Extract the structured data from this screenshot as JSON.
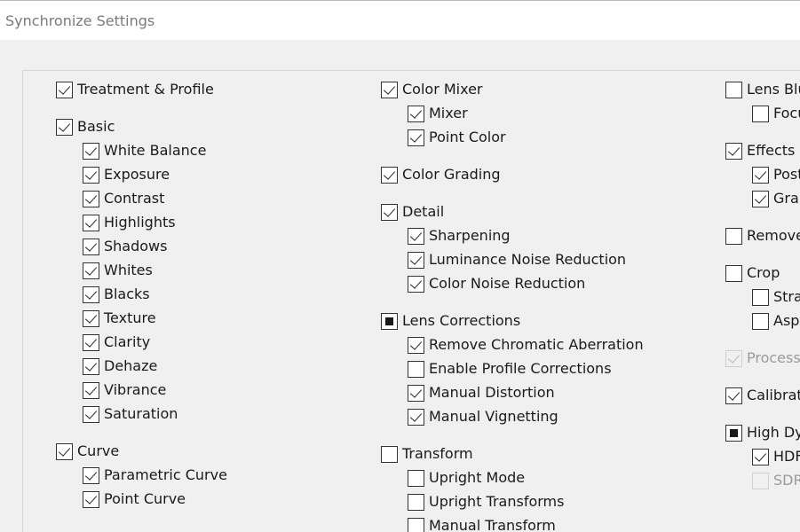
{
  "window": {
    "title": "Synchronize Settings"
  },
  "columns": [
    {
      "items": [
        {
          "label": "Treatment & Profile",
          "state": "checked",
          "indent": false,
          "disabled": false
        },
        {
          "label": "Basic",
          "state": "checked",
          "indent": false,
          "disabled": false
        },
        {
          "label": "White Balance",
          "state": "checked",
          "indent": true,
          "disabled": false
        },
        {
          "label": "Exposure",
          "state": "checked",
          "indent": true,
          "disabled": false
        },
        {
          "label": "Contrast",
          "state": "checked",
          "indent": true,
          "disabled": false
        },
        {
          "label": "Highlights",
          "state": "checked",
          "indent": true,
          "disabled": false
        },
        {
          "label": "Shadows",
          "state": "checked",
          "indent": true,
          "disabled": false
        },
        {
          "label": "Whites",
          "state": "checked",
          "indent": true,
          "disabled": false
        },
        {
          "label": "Blacks",
          "state": "checked",
          "indent": true,
          "disabled": false
        },
        {
          "label": "Texture",
          "state": "checked",
          "indent": true,
          "disabled": false
        },
        {
          "label": "Clarity",
          "state": "checked",
          "indent": true,
          "disabled": false
        },
        {
          "label": "Dehaze",
          "state": "checked",
          "indent": true,
          "disabled": false
        },
        {
          "label": "Vibrance",
          "state": "checked",
          "indent": true,
          "disabled": false
        },
        {
          "label": "Saturation",
          "state": "checked",
          "indent": true,
          "disabled": false
        },
        {
          "label": "Curve",
          "state": "checked",
          "indent": false,
          "disabled": false
        },
        {
          "label": "Parametric Curve",
          "state": "checked",
          "indent": true,
          "disabled": false
        },
        {
          "label": "Point Curve",
          "state": "checked",
          "indent": true,
          "disabled": false
        }
      ]
    },
    {
      "items": [
        {
          "label": "Color Mixer",
          "state": "checked",
          "indent": false,
          "disabled": false
        },
        {
          "label": "Mixer",
          "state": "checked",
          "indent": true,
          "disabled": false
        },
        {
          "label": "Point Color",
          "state": "checked",
          "indent": true,
          "disabled": false
        },
        {
          "label": "Color Grading",
          "state": "checked",
          "indent": false,
          "disabled": false
        },
        {
          "label": "Detail",
          "state": "checked",
          "indent": false,
          "disabled": false
        },
        {
          "label": "Sharpening",
          "state": "checked",
          "indent": true,
          "disabled": false
        },
        {
          "label": "Luminance Noise Reduction",
          "state": "checked",
          "indent": true,
          "disabled": false
        },
        {
          "label": "Color Noise Reduction",
          "state": "checked",
          "indent": true,
          "disabled": false
        },
        {
          "label": "Lens Corrections",
          "state": "mixed",
          "indent": false,
          "disabled": false
        },
        {
          "label": "Remove Chromatic Aberration",
          "state": "checked",
          "indent": true,
          "disabled": false
        },
        {
          "label": "Enable Profile Corrections",
          "state": "unchecked",
          "indent": true,
          "disabled": false
        },
        {
          "label": "Manual Distortion",
          "state": "checked",
          "indent": true,
          "disabled": false
        },
        {
          "label": "Manual Vignetting",
          "state": "checked",
          "indent": true,
          "disabled": false
        },
        {
          "label": "Transform",
          "state": "unchecked",
          "indent": false,
          "disabled": false
        },
        {
          "label": "Upright Mode",
          "state": "unchecked",
          "indent": true,
          "disabled": false
        },
        {
          "label": "Upright Transforms",
          "state": "unchecked",
          "indent": true,
          "disabled": false
        },
        {
          "label": "Manual Transform",
          "state": "unchecked",
          "indent": true,
          "disabled": false
        }
      ]
    },
    {
      "items": [
        {
          "label": "Lens Blu",
          "state": "unchecked",
          "indent": false,
          "disabled": false
        },
        {
          "label": "Focu",
          "state": "unchecked",
          "indent": true,
          "disabled": false
        },
        {
          "label": "Effects",
          "state": "checked",
          "indent": false,
          "disabled": false
        },
        {
          "label": "Post",
          "state": "checked",
          "indent": true,
          "disabled": false
        },
        {
          "label": "Grai",
          "state": "checked",
          "indent": true,
          "disabled": false
        },
        {
          "label": "Remove",
          "state": "unchecked",
          "indent": false,
          "disabled": false
        },
        {
          "label": "Crop",
          "state": "unchecked",
          "indent": false,
          "disabled": false
        },
        {
          "label": "Stra",
          "state": "unchecked",
          "indent": true,
          "disabled": false
        },
        {
          "label": "Asp",
          "state": "unchecked",
          "indent": true,
          "disabled": false
        },
        {
          "label": "Process",
          "state": "checked",
          "indent": false,
          "disabled": true
        },
        {
          "label": "Calibrati",
          "state": "checked",
          "indent": false,
          "disabled": false
        },
        {
          "label": "High Dyr",
          "state": "mixed",
          "indent": false,
          "disabled": false
        },
        {
          "label": "HDF",
          "state": "checked",
          "indent": true,
          "disabled": false
        },
        {
          "label": "SDR",
          "state": "unchecked",
          "indent": true,
          "disabled": true
        }
      ]
    }
  ]
}
